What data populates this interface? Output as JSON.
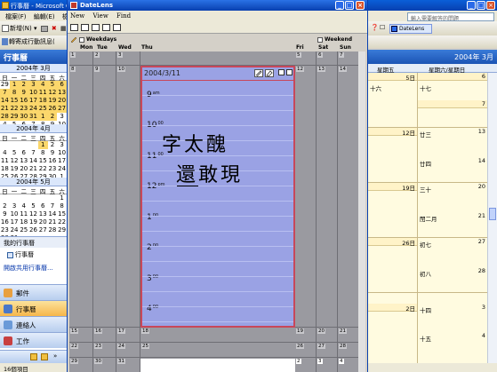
{
  "outlook": {
    "title": "行事曆 - Microsoft O",
    "menu": [
      "檔案(F)",
      "編輯(E)",
      "檢"
    ],
    "toolbar_new": "新增(N)",
    "toolbar_forward": "轉寄成行動訊息(",
    "ask_placeholder": "輸入需要解答的問題",
    "datelens_button": "DateLens",
    "nav_title": "行事曆",
    "mini_calendars": [
      {
        "month": "2004年 3月",
        "weekdays": [
          "日",
          "一",
          "二",
          "三",
          "四",
          "五",
          "六"
        ],
        "days": [
          "29",
          "1",
          "2",
          "3",
          "4",
          "5",
          "6",
          "7",
          "8",
          "9",
          "10",
          "11",
          "12",
          "13",
          "14",
          "15",
          "16",
          "17",
          "18",
          "19",
          "20",
          "21",
          "22",
          "23",
          "24",
          "25",
          "26",
          "27",
          "28",
          "29",
          "30",
          "31",
          "1",
          "2",
          "3",
          "4",
          "5",
          "6",
          "7",
          "8",
          "9",
          "10"
        ]
      },
      {
        "month": "2004年 4月",
        "weekdays": [
          "日",
          "一",
          "二",
          "三",
          "四",
          "五",
          "六"
        ],
        "days": [
          "",
          "",
          "",
          "",
          "1",
          "2",
          "3",
          "4",
          "5",
          "6",
          "7",
          "8",
          "9",
          "10",
          "11",
          "12",
          "13",
          "14",
          "15",
          "16",
          "17",
          "18",
          "19",
          "20",
          "21",
          "22",
          "23",
          "24",
          "25",
          "26",
          "27",
          "28",
          "29",
          "30",
          "1"
        ]
      },
      {
        "month": "2004年 5月",
        "weekdays": [
          "日",
          "一",
          "二",
          "三",
          "四",
          "五",
          "六"
        ],
        "days": [
          "",
          "",
          "",
          "",
          "",
          "",
          "1",
          "2",
          "3",
          "4",
          "5",
          "6",
          "7",
          "8",
          "9",
          "10",
          "11",
          "12",
          "13",
          "14",
          "15",
          "16",
          "17",
          "18",
          "19",
          "20",
          "21",
          "22",
          "23",
          "24",
          "25",
          "26",
          "27",
          "28",
          "29",
          "30",
          "31"
        ]
      }
    ],
    "my_calendars_header": "我的行事曆",
    "my_calendar_item": "行事曆",
    "open_shared": "開啟共用行事曆...",
    "nav_buttons": [
      "郵件",
      "行事曆",
      "連絡人",
      "工作"
    ],
    "status": "16個項目",
    "right_header": "2004年 3月",
    "right_columns": [
      "星期五",
      "星期六/星期日"
    ],
    "right_weeks": [
      {
        "fri": "5日",
        "fri_sub": "十六",
        "sat": "6",
        "sat_sub": "十七",
        "sun": "7"
      },
      {
        "fri": "12日",
        "fri_sub": "廿三",
        "sat": "13",
        "sat_sub": "廿四",
        "sun": "14"
      },
      {
        "fri": "19日",
        "fri_sub": "三十",
        "sat": "20",
        "sat_sub": "閏二月",
        "sun": "21"
      },
      {
        "fri": "26日",
        "fri_sub": "初七",
        "sat": "27",
        "sat_sub": "初八",
        "sun": "28"
      },
      {
        "fri": "2日",
        "fri_sub": "十四",
        "sat": "3",
        "sat_sub": "十五",
        "sun": "4"
      }
    ]
  },
  "datelens": {
    "title": "DateLens",
    "menu": [
      "New",
      "View",
      "Find"
    ],
    "weekdays_label": "Weekdays",
    "weekend_label": "Weekend",
    "day_headers": [
      "Mon",
      "Tue",
      "Wed",
      "Thu",
      "Fri",
      "Sat",
      "Sun"
    ],
    "grid_dates": [
      [
        "1",
        "2",
        "3",
        "",
        "5",
        "6",
        "7"
      ],
      [
        "8",
        "9",
        "10",
        "",
        "12",
        "13",
        "14"
      ],
      [
        "15",
        "16",
        "17",
        "18",
        "19",
        "20",
        "21"
      ],
      [
        "22",
        "23",
        "24",
        "25",
        "26",
        "27",
        "28"
      ],
      [
        "29",
        "30",
        "31",
        "1",
        "2",
        "3",
        "4"
      ]
    ],
    "focus": {
      "date": "2004/3/11",
      "hours": [
        {
          "num": "9",
          "suf": "am"
        },
        {
          "num": "10",
          "suf": "00"
        },
        {
          "num": "11",
          "suf": "00"
        },
        {
          "num": "12",
          "suf": "pm"
        },
        {
          "num": "1",
          "suf": "00"
        },
        {
          "num": "2",
          "suf": "00"
        },
        {
          "num": "3",
          "suf": "00"
        },
        {
          "num": "4",
          "suf": "00"
        }
      ],
      "handwriting_line1": "字太醜",
      "handwriting_line2": "還敢現"
    }
  }
}
